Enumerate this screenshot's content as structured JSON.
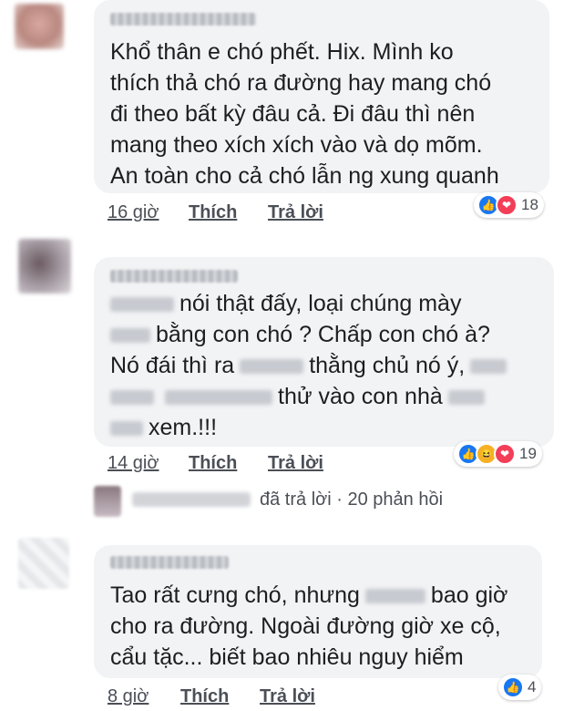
{
  "comments": [
    {
      "lines": [
        "Khổ thân e chó phết. Hix. Mình ko",
        "thích thả chó ra đường hay mang chó",
        "đi theo bất kỳ đâu cả. Đi đâu thì nên",
        "mang theo xích xích vào và dọ mõm.",
        "An toàn cho cả chó lẫn ng xung quanh"
      ],
      "time": "16 giờ",
      "like_label": "Thích",
      "reply_label": "Trả lời",
      "reaction_count": "18"
    },
    {
      "line1": "nói thật đấy, loại chúng mày",
      "line2": "bằng con chó ? Chấp con chó à?",
      "line3a": "Nó đái thì ra",
      "line3b": "thằng chủ nó ý,",
      "line4": "thử vào con nhà",
      "line5": "xem.!!!",
      "time": "14 giờ",
      "like_label": "Thích",
      "reply_label": "Trả lời",
      "reaction_count": "19"
    },
    {
      "line1a": "Tao rất cưng chó, nhưng",
      "line1b": "bao giờ",
      "line2": "cho ra đường. Ngoài đường giờ xe cộ,",
      "line3": "cẩu tặc... biết bao nhiêu nguy hiểm",
      "time": "8 giờ",
      "like_label": "Thích",
      "reply_label": "Trả lời",
      "reaction_count": "4"
    }
  ],
  "replies": {
    "text": "đã trả lời · 20 phản hồi"
  },
  "icons": {
    "like": "👍",
    "love": "❤",
    "haha": "😆"
  }
}
